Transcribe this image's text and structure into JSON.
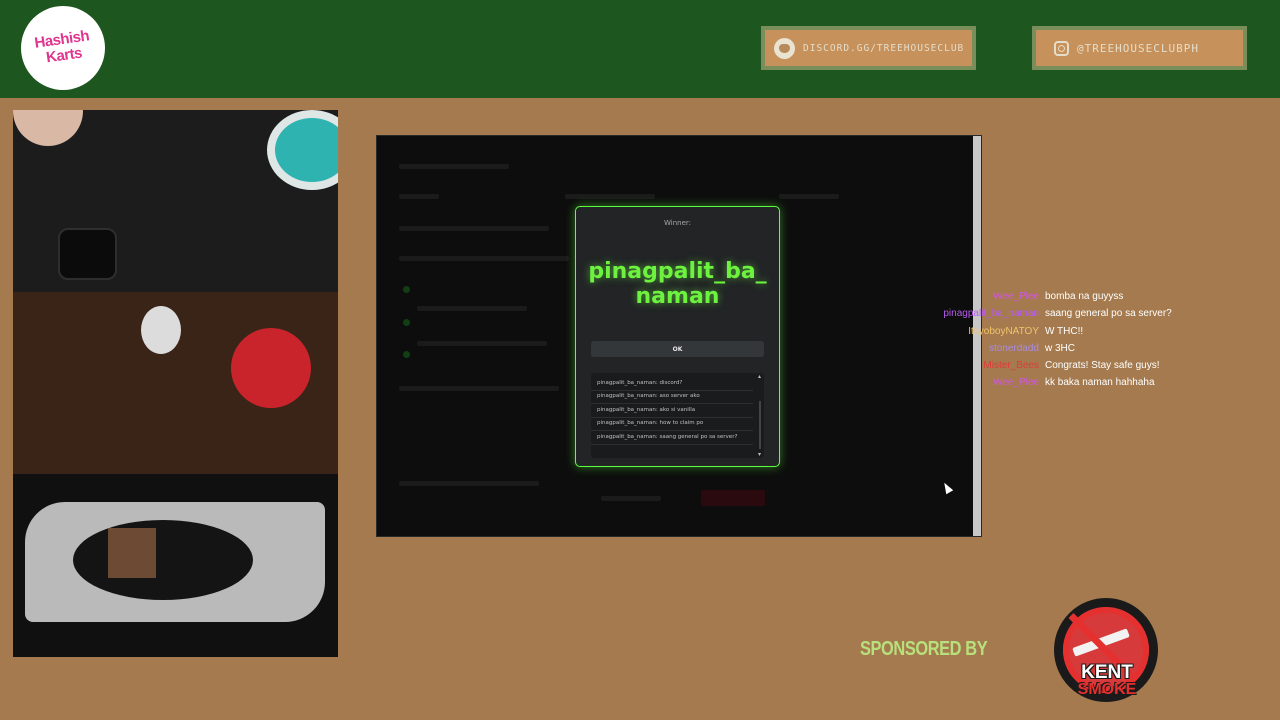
{
  "header": {
    "logo_text": "Hashish Karts",
    "discord_label": "DISCORD.GG/TREEHOUSECLUB",
    "instagram_label": "@TREEHOUSECLUBPH"
  },
  "modal": {
    "label": "Winner:",
    "winner_name": "pinagpalit_ba_naman",
    "ok_label": "OK",
    "log": [
      "pinagpalit_ba_naman: discord?",
      "pinagpalit_ba_naman: aso server ako",
      "pinagpalit_ba_naman: ako si vanilla",
      "pinagpalit_ba_naman: how to claim po",
      "pinagpalit_ba_naman: saang general po sa server?"
    ]
  },
  "chat": [
    {
      "user": "Wee_Plee",
      "color": "#d05ad6",
      "message": "bomba na guyyss"
    },
    {
      "user": "pinagpalit_ba_naman",
      "color": "#b85cf0",
      "message": "saang general po sa server?"
    },
    {
      "user": "ItsyoboyNATOY",
      "color": "#f2c46b",
      "message": "W THC!!"
    },
    {
      "user": "stonerdadd",
      "color": "#a88ce0",
      "message": "w 3HC"
    },
    {
      "user": "Mister_Bees",
      "color": "#e23a3a",
      "message": "Congrats! Stay safe guys!"
    },
    {
      "user": "Wee_Plee",
      "color": "#d05ad6",
      "message": "kk baka naman hahhaha"
    }
  ],
  "sponsor": {
    "label": "SPONSORED BY",
    "brand_line1": "KENT",
    "brand_line2": "SMOKE"
  },
  "colors": {
    "header_bg": "#1d561e",
    "page_bg": "#a47a4e",
    "winner_green": "#6cf23f"
  }
}
